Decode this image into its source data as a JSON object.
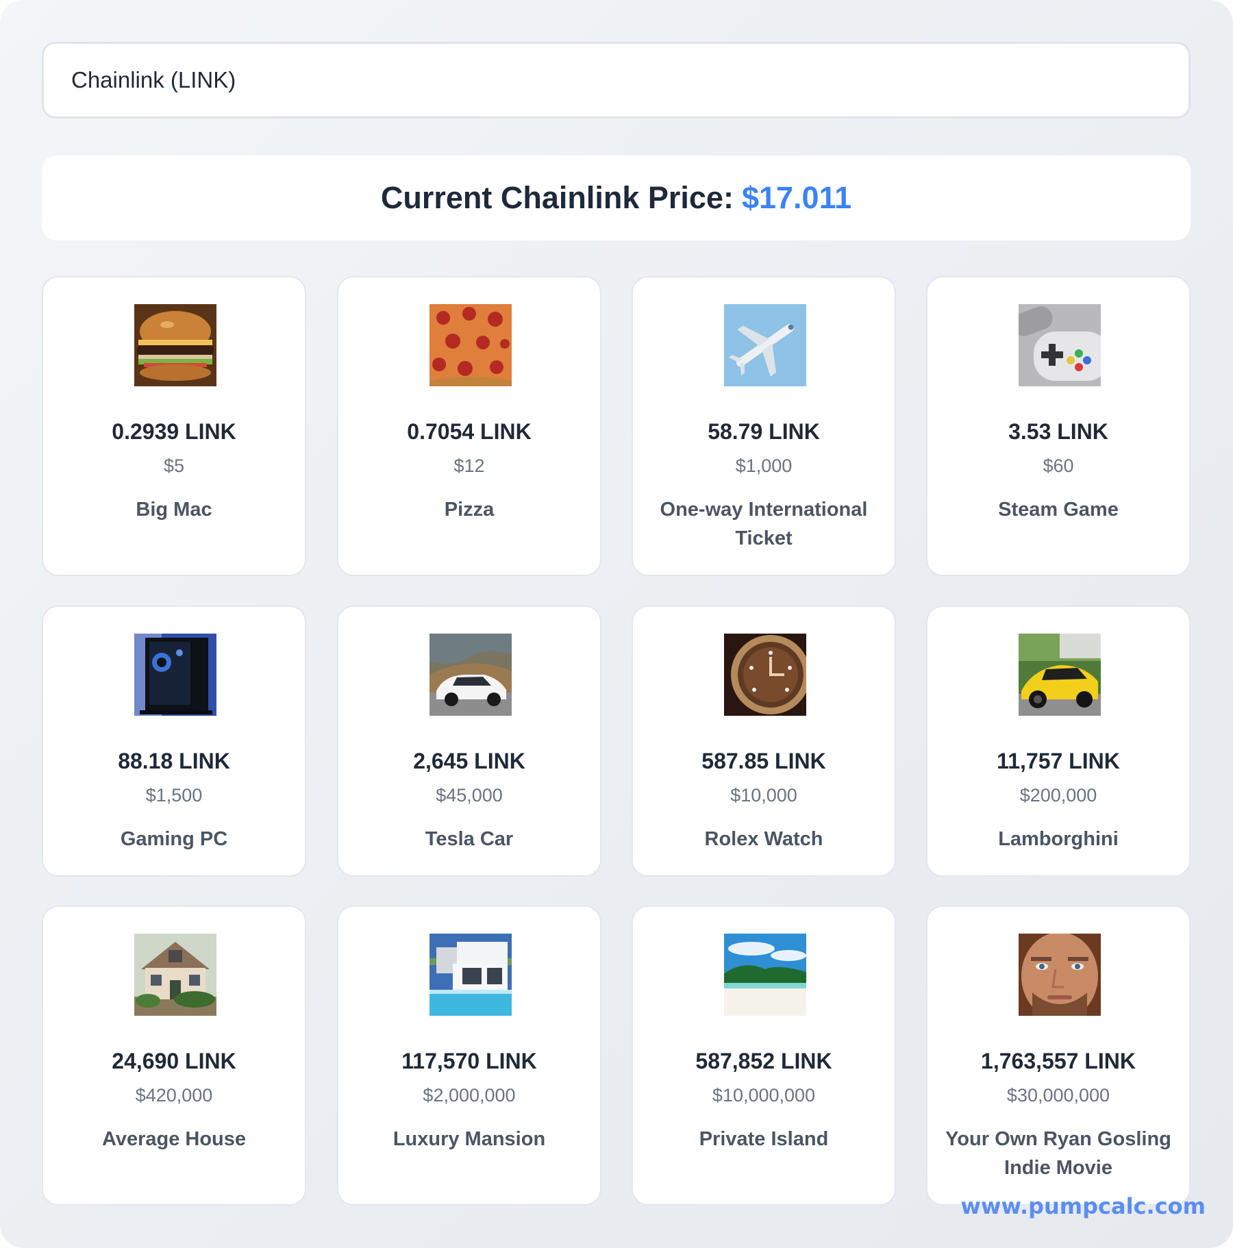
{
  "search": {
    "value": "Chainlink (LINK)"
  },
  "price_banner": {
    "label": "Current Chainlink Price:",
    "value": "$17.011"
  },
  "items": [
    {
      "amount": "0.2939 LINK",
      "usd": "$5",
      "label": "Big Mac",
      "icon": "burger-icon"
    },
    {
      "amount": "0.7054 LINK",
      "usd": "$12",
      "label": "Pizza",
      "icon": "pizza-icon"
    },
    {
      "amount": "58.79 LINK",
      "usd": "$1,000",
      "label": "One-way International Ticket",
      "icon": "airplane-icon"
    },
    {
      "amount": "3.53 LINK",
      "usd": "$60",
      "label": "Steam Game",
      "icon": "game-controller-icon"
    },
    {
      "amount": "88.18 LINK",
      "usd": "$1,500",
      "label": "Gaming PC",
      "icon": "gaming-pc-icon"
    },
    {
      "amount": "2,645 LINK",
      "usd": "$45,000",
      "label": "Tesla Car",
      "icon": "car-icon"
    },
    {
      "amount": "587.85 LINK",
      "usd": "$10,000",
      "label": "Rolex Watch",
      "icon": "watch-icon"
    },
    {
      "amount": "11,757 LINK",
      "usd": "$200,000",
      "label": "Lamborghini",
      "icon": "sports-car-icon"
    },
    {
      "amount": "24,690 LINK",
      "usd": "$420,000",
      "label": "Average House",
      "icon": "house-icon"
    },
    {
      "amount": "117,570 LINK",
      "usd": "$2,000,000",
      "label": "Luxury Mansion",
      "icon": "mansion-icon"
    },
    {
      "amount": "587,852 LINK",
      "usd": "$10,000,000",
      "label": "Private Island",
      "icon": "island-icon"
    },
    {
      "amount": "1,763,557 LINK",
      "usd": "$30,000,000",
      "label": "Your Own Ryan Gosling Indie Movie",
      "icon": "face-portrait-icon"
    }
  ],
  "watermark": "www.pumpcalc.com",
  "colors": {
    "accent": "#3b82f6",
    "watermark": "#5b8ef0",
    "heading": "#1e293b"
  }
}
